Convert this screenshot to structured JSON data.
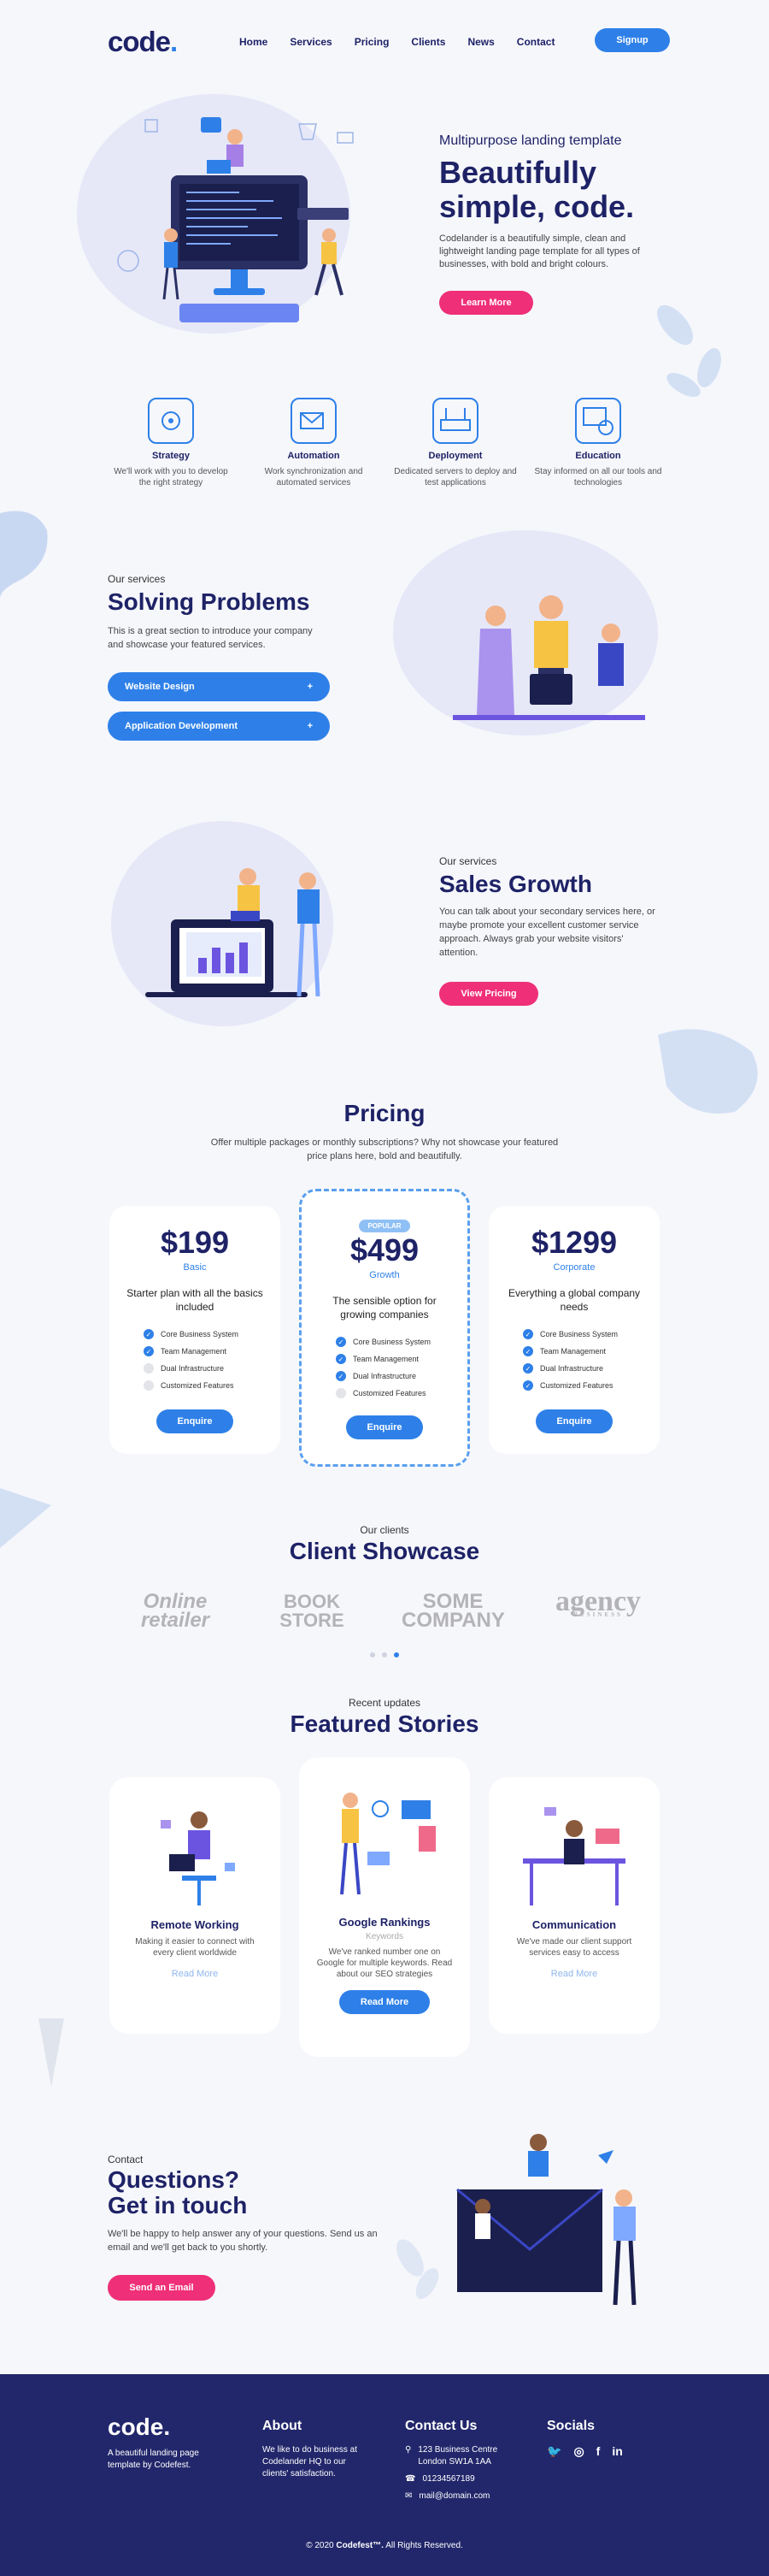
{
  "header": {
    "logo": "code",
    "nav": [
      "Home",
      "Services",
      "Pricing",
      "Clients",
      "News",
      "Contact"
    ],
    "signup": "Signup"
  },
  "hero": {
    "subtitle": "Multipurpose landing template",
    "title": "Beautifully simple, code.",
    "description": "Codelander is a beautifully simple, clean and lightweight landing page template for all types of businesses, with bold and bright colours.",
    "button": "Learn More"
  },
  "features": [
    {
      "icon": "strategy-icon",
      "title": "Strategy",
      "text": "We'll work with you to develop the right strategy"
    },
    {
      "icon": "automation-icon",
      "title": "Automation",
      "text": "Work synchronization and automated services"
    },
    {
      "icon": "deployment-icon",
      "title": "Deployment",
      "text": "Dedicated servers to deploy and test applications"
    },
    {
      "icon": "education-icon",
      "title": "Education",
      "text": "Stay informed on all our tools and technologies"
    }
  ],
  "services": {
    "kicker": "Our services",
    "title": "Solving Problems",
    "text": "This is a great section to introduce your company and showcase your featured services.",
    "items": [
      "Website Design",
      "Application Development"
    ]
  },
  "sales": {
    "kicker": "Our services",
    "title": "Sales Growth",
    "text": "You can talk about your secondary services here, or maybe promote your excellent customer service approach. Always grab your website visitors' attention.",
    "button": "View Pricing"
  },
  "pricing": {
    "title": "Pricing",
    "subtitle": "Offer multiple packages or monthly subscriptions? Why not showcase your featured price plans here, bold and beautifully.",
    "plans": [
      {
        "price": "$199",
        "tier": "Basic",
        "desc": "Starter plan with all the basics included",
        "features": [
          "Core Business System",
          "Team Management",
          "Dual Infrastructure",
          "Customized Features"
        ],
        "enabled": [
          true,
          true,
          false,
          false
        ],
        "button": "Enquire"
      },
      {
        "badge": "POPULAR",
        "price": "$499",
        "tier": "Growth",
        "desc": "The sensible option for growing companies",
        "features": [
          "Core Business System",
          "Team Management",
          "Dual Infrastructure",
          "Customized Features"
        ],
        "enabled": [
          true,
          true,
          true,
          false
        ],
        "button": "Enquire"
      },
      {
        "price": "$1299",
        "tier": "Corporate",
        "desc": "Everything a global company needs",
        "features": [
          "Core Business System",
          "Team Management",
          "Dual Infrastructure",
          "Customized Features"
        ],
        "enabled": [
          true,
          true,
          true,
          true
        ],
        "button": "Enquire"
      }
    ]
  },
  "clients": {
    "kicker": "Our clients",
    "title": "Client Showcase",
    "logos": [
      "Online retailer",
      "BOOK STORE",
      "SOME COMPANY",
      "agency"
    ],
    "logo_sub": "BUSINESS"
  },
  "stories": {
    "kicker": "Recent updates",
    "title": "Featured Stories",
    "items": [
      {
        "title": "Remote Working",
        "text": "Making it easier to connect with every client worldwide",
        "link": "Read More"
      },
      {
        "title": "Google Rankings",
        "sub": "Keywords",
        "text": "We've ranked number one on Google for multiple keywords. Read about our SEO strategies",
        "button": "Read More"
      },
      {
        "title": "Communication",
        "text": "We've made our client support services easy to access",
        "link": "Read More"
      }
    ]
  },
  "contact": {
    "kicker": "Contact",
    "title_line1": "Questions?",
    "title_line2": "Get in touch",
    "text": "We'll be happy to help answer any of your questions. Send us an email and we'll get back to you shortly.",
    "button": "Send an Email"
  },
  "footer": {
    "logo": "code.",
    "tagline": "A beautiful landing page template by Codefest.",
    "about_title": "About",
    "about_text": "We like to do business at Codelander HQ to our clients' satisfaction.",
    "contact_title": "Contact Us",
    "address1": "123 Business Centre",
    "address2": "London SW1A 1AA",
    "phone": "01234567189",
    "email": "mail@domain.com",
    "socials_title": "Socials",
    "copyright_pre": "© 2020",
    "copyright_brand": "Codefest™.",
    "copyright_post": "All Rights Reserved."
  },
  "colors": {
    "navy": "#1e2266",
    "blue": "#2e80e8",
    "pink": "#ef2f78"
  }
}
